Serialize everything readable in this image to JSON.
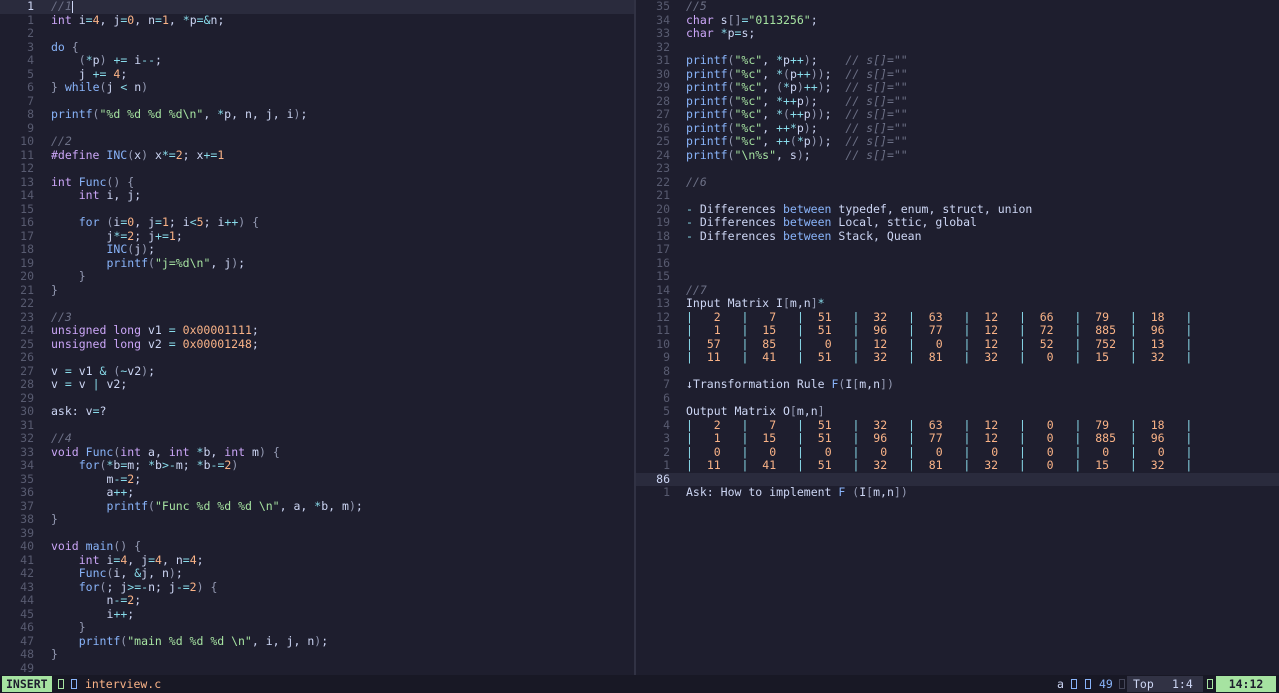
{
  "editor": {
    "left_pane": {
      "lines": [
        {
          "num": "1",
          "text": "//1",
          "current": true
        },
        {
          "num": "1",
          "text": "int i=4, j=0, n=1, *p=&n;"
        },
        {
          "num": "2",
          "text": ""
        },
        {
          "num": "3",
          "text": "do {"
        },
        {
          "num": "4",
          "text": "    (*p) += i--;"
        },
        {
          "num": "5",
          "text": "    j += 4;"
        },
        {
          "num": "6",
          "text": "} while(j < n)"
        },
        {
          "num": "7",
          "text": ""
        },
        {
          "num": "8",
          "text": "printf(\"%d %d %d %d\\n\", *p, n, j, i);"
        },
        {
          "num": "9",
          "text": ""
        },
        {
          "num": "10",
          "text": "//2"
        },
        {
          "num": "11",
          "text": "#define INC(x) x*=2; x+=1"
        },
        {
          "num": "12",
          "text": ""
        },
        {
          "num": "13",
          "text": "int Func() {"
        },
        {
          "num": "14",
          "text": "    int i, j;"
        },
        {
          "num": "15",
          "text": ""
        },
        {
          "num": "16",
          "text": "    for (i=0, j=1; i<5; i++) {"
        },
        {
          "num": "17",
          "text": "        j*=2; j+=1;"
        },
        {
          "num": "18",
          "text": "        INC(j);"
        },
        {
          "num": "19",
          "text": "        printf(\"j=%d\\n\", j);"
        },
        {
          "num": "20",
          "text": "    }"
        },
        {
          "num": "21",
          "text": "}"
        },
        {
          "num": "22",
          "text": ""
        },
        {
          "num": "23",
          "text": "//3"
        },
        {
          "num": "24",
          "text": "unsigned long v1 = 0x00001111;"
        },
        {
          "num": "25",
          "text": "unsigned long v2 = 0x00001248;"
        },
        {
          "num": "26",
          "text": ""
        },
        {
          "num": "27",
          "text": "v = v1 & (~v2);"
        },
        {
          "num": "28",
          "text": "v = v | v2;"
        },
        {
          "num": "29",
          "text": ""
        },
        {
          "num": "30",
          "text": "ask: v=?"
        },
        {
          "num": "31",
          "text": ""
        },
        {
          "num": "32",
          "text": "//4"
        },
        {
          "num": "33",
          "text": "void Func(int a, int *b, int m) {"
        },
        {
          "num": "34",
          "text": "    for(*b=m; *b>-m; *b-=2)"
        },
        {
          "num": "35",
          "text": "        m-=2;"
        },
        {
          "num": "36",
          "text": "        a++;"
        },
        {
          "num": "37",
          "text": "        printf(\"Func %d %d %d \\n\", a, *b, m);"
        },
        {
          "num": "38",
          "text": "}"
        },
        {
          "num": "39",
          "text": ""
        },
        {
          "num": "40",
          "text": "void main() {"
        },
        {
          "num": "41",
          "text": "    int i=4, j=4, n=4;"
        },
        {
          "num": "42",
          "text": "    Func(i, &j, n);"
        },
        {
          "num": "43",
          "text": "    for(; j>=-n; j-=2) {"
        },
        {
          "num": "44",
          "text": "        n-=2;"
        },
        {
          "num": "45",
          "text": "        i++;"
        },
        {
          "num": "46",
          "text": "    }"
        },
        {
          "num": "47",
          "text": "    printf(\"main %d %d %d \\n\", i, j, n);"
        },
        {
          "num": "48",
          "text": "}"
        },
        {
          "num": "49",
          "text": ""
        }
      ]
    },
    "right_pane": {
      "lines": [
        {
          "num": "35",
          "text": "//5"
        },
        {
          "num": "34",
          "text": "char s[]=\"0113256\";"
        },
        {
          "num": "33",
          "text": "char *p=s;"
        },
        {
          "num": "32",
          "text": ""
        },
        {
          "num": "31",
          "text": "printf(\"%c\", *p++);    // s[]=\"\""
        },
        {
          "num": "30",
          "text": "printf(\"%c\", *(p++));  // s[]=\"\""
        },
        {
          "num": "29",
          "text": "printf(\"%c\", (*p)++);  // s[]=\"\""
        },
        {
          "num": "28",
          "text": "printf(\"%c\", *++p);    // s[]=\"\""
        },
        {
          "num": "27",
          "text": "printf(\"%c\", *(++p));  // s[]=\"\""
        },
        {
          "num": "26",
          "text": "printf(\"%c\", ++*p);    // s[]=\"\""
        },
        {
          "num": "25",
          "text": "printf(\"%c\", ++(*p));  // s[]=\"\""
        },
        {
          "num": "24",
          "text": "printf(\"\\n%s\", s);     // s[]=\"\""
        },
        {
          "num": "23",
          "text": ""
        },
        {
          "num": "22",
          "text": "//6"
        },
        {
          "num": "21",
          "text": ""
        },
        {
          "num": "20",
          "text": "- Differences between typedef, enum, struct, union"
        },
        {
          "num": "19",
          "text": "- Differences between Local, sttic, global"
        },
        {
          "num": "18",
          "text": "- Differences between Stack, Quean"
        },
        {
          "num": "17",
          "text": ""
        },
        {
          "num": "16",
          "text": ""
        },
        {
          "num": "15",
          "text": ""
        },
        {
          "num": "14",
          "text": "//7"
        },
        {
          "num": "13",
          "text": "Input Matrix I[m,n]*"
        },
        {
          "num": "12",
          "text": "|   2   |   7   |  51   |  32   |  63   |  12   |  66   |  79   |  18   |"
        },
        {
          "num": "11",
          "text": "|   1   |  15   |  51   |  96   |  77   |  12   |  72   |  885  |  96   |"
        },
        {
          "num": "10",
          "text": "|  57   |  85   |   0   |  12   |   0   |  12   |  52   |  752  |  13   |"
        },
        {
          "num": "9",
          "text": "|  11   |  41   |  51   |  32   |  81   |  32   |   0   |  15   |  32   |"
        },
        {
          "num": "8",
          "text": ""
        },
        {
          "num": "7",
          "text": "↓Transformation Rule F(I[m,n])"
        },
        {
          "num": "6",
          "text": ""
        },
        {
          "num": "5",
          "text": "Output Matrix O[m,n]"
        },
        {
          "num": "4",
          "text": "|   2   |   7   |  51   |  32   |  63   |  12   |   0   |  79   |  18   |"
        },
        {
          "num": "3",
          "text": "|   1   |  15   |  51   |  96   |  77   |  12   |   0   |  885  |  96   |"
        },
        {
          "num": "2",
          "text": "|   0   |   0   |   0   |   0   |   0   |   0   |   0   |   0   |   0   |"
        },
        {
          "num": "1",
          "text": "|  11   |  41   |  51   |  32   |  81   |  32   |   0   |  15   |  32   |"
        },
        {
          "num": "86",
          "text": "",
          "current": true
        },
        {
          "num": "1",
          "text": "Ask: How to implement F (I[m,n])"
        }
      ]
    }
  },
  "statusbar": {
    "mode": "INSERT",
    "filename": "interview.c",
    "register": "a",
    "count": "49",
    "scroll": "Top",
    "position": "1:4",
    "time": "14:12"
  },
  "colors": {
    "background": "#1e1e2e",
    "mode_green": "#a6e3a1",
    "filename_orange": "#fab387",
    "keyword_blue": "#89b4fa",
    "number_orange": "#fab387",
    "string_green": "#a6e3a1",
    "comment_gray": "#6c7086"
  }
}
